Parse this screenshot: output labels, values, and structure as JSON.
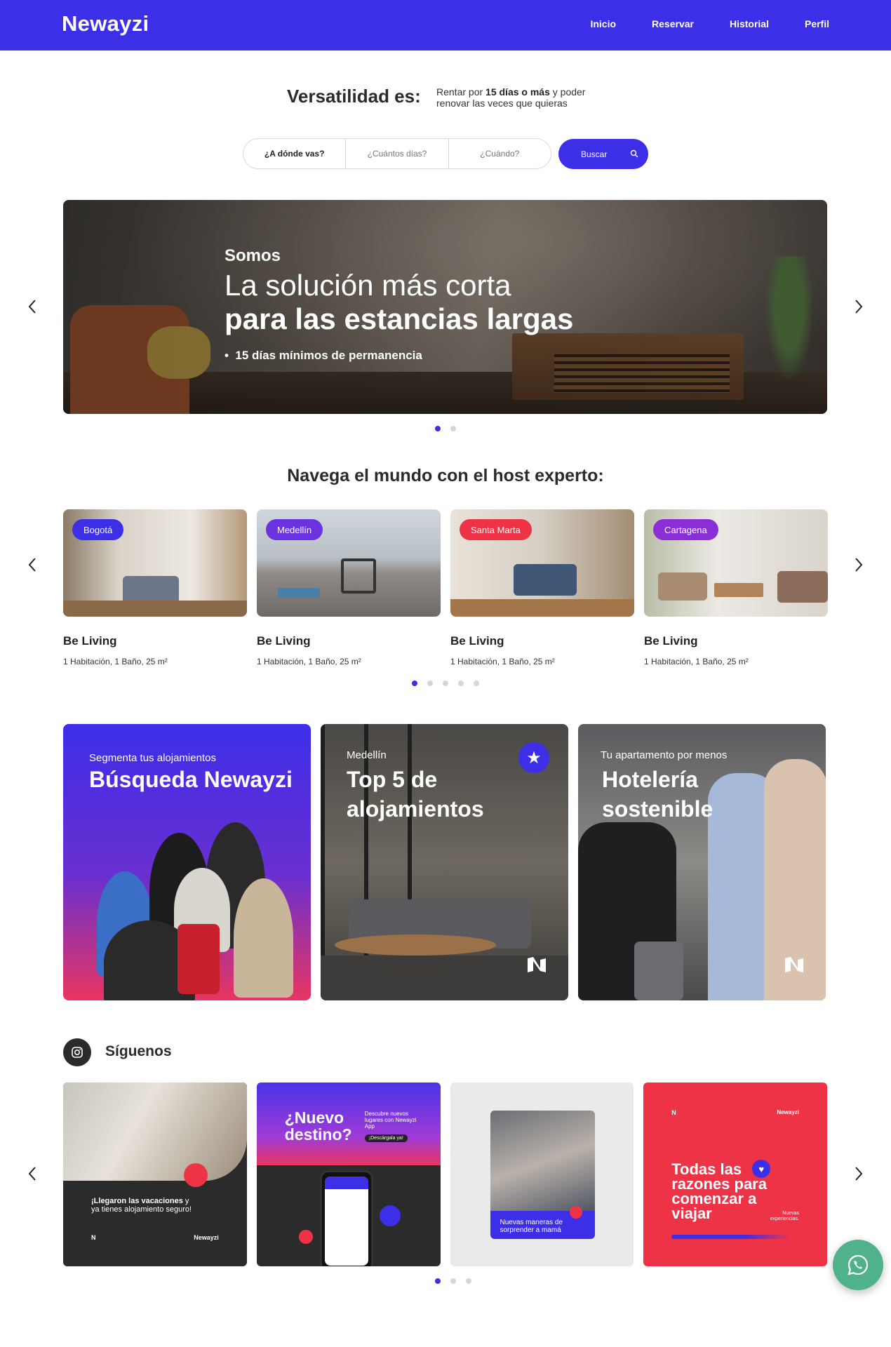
{
  "nav": {
    "brand": "Newayzi",
    "links": [
      "Inicio",
      "Reservar",
      "Historial",
      "Perfil"
    ]
  },
  "hero_intro": {
    "tagline": "Versatilidad es:",
    "desc_pre": "Rentar por ",
    "desc_bold": "15 días o más",
    "desc_post": " y poder renovar las veces que quieras"
  },
  "search": {
    "destination_label": "¿A dónde vas?",
    "days_label": "¿Cuántos días?",
    "when_label": "¿Cuándo?",
    "button_label": "Buscar"
  },
  "banner": {
    "kicker": "Somos",
    "line1": "La solución más corta",
    "line2": "para las estancias largas",
    "bullet": "15 días mínimos de permanencia",
    "slides_count": 2,
    "active_slide": 1
  },
  "properties": {
    "title": "Navega el mundo con el host experto:",
    "items": [
      {
        "city": "Bogotá",
        "city_color": "#3d2ee8",
        "name": "Be Living",
        "desc": "1 Habitación, 1 Baño, 25 m²"
      },
      {
        "city": "Medellín",
        "city_color": "#6a32e0",
        "name": "Be Living",
        "desc": "1 Habitación, 1 Baño, 25 m²"
      },
      {
        "city": "Santa Marta",
        "city_color": "#ee3347",
        "name": "Be Living",
        "desc": "1 Habitación, 1 Baño, 25 m²"
      },
      {
        "city": "Cartagena",
        "city_color": "#8a2fd6",
        "name": "Be Living",
        "desc": "1 Habitación, 1 Baño, 25 m²"
      }
    ],
    "pages_count": 5,
    "active_page": 1
  },
  "promos": [
    {
      "small": "Segmenta tus alojamientos",
      "big": "Búsqueda Newayzi"
    },
    {
      "small": "Medellín",
      "big_line1": "Top 5 de",
      "big_line2": "alojamientos"
    },
    {
      "small": "Tu apartamento por menos",
      "big_line1": "Hotelería",
      "big_line2": "sostenible"
    }
  ],
  "social": {
    "title": "Síguenos",
    "posts": [
      {
        "text_bold": "¡Llegaron las vacaciones",
        "text_rest": " y ya tienes alojamiento seguro!",
        "brand": "Newayzi"
      },
      {
        "big_line1": "¿Nuevo",
        "big_line2": "destino?",
        "small": "Descubre nuevos lugares con Newayzi App",
        "pill": "¡Descárgala ya!"
      },
      {
        "text": "Nuevas maneras de sorprender a mamá"
      },
      {
        "brand": "Newayzi",
        "big": "Todas las razones para comenzar a viajar",
        "small": "Nuevas experiencias."
      }
    ],
    "pages_count": 3,
    "active_page": 1
  },
  "colors": {
    "primary": "#3d2ee8",
    "accent_red": "#ee3347",
    "whatsapp": "#4fb28a"
  }
}
